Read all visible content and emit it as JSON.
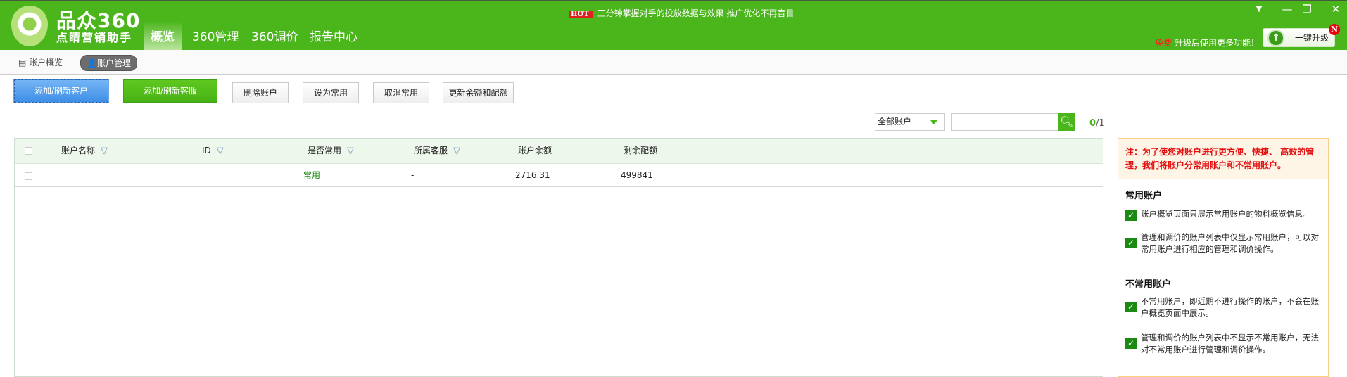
{
  "app": {
    "brand": "品众360",
    "slogan": "点睛营销助手"
  },
  "nav": {
    "tabs": [
      {
        "label": "概览",
        "active": true
      },
      {
        "label": "360管理"
      },
      {
        "label": "360调价"
      },
      {
        "label": "报告中心"
      }
    ]
  },
  "promo": {
    "badge": "HOT",
    "text": "三分钟掌握对手的投放数据与效果  推广优化不再盲目"
  },
  "window": {
    "menu": "▼",
    "minimize": "—",
    "maximize": "❐",
    "close": "✕"
  },
  "upgrade": {
    "free": "免费",
    "text": "升级后使用更多功能！",
    "button": "一键升级",
    "badge": "N"
  },
  "subnav": {
    "items": [
      {
        "label": "账户概览"
      },
      {
        "label": "账户管理",
        "active": true
      }
    ]
  },
  "toolbar": {
    "add_client": "添加/刷新客户",
    "add_service": "添加/刷新客服",
    "delete": "删除账户",
    "set_common": "设为常用",
    "cancel_common": "取消常用",
    "update_balance": "更新余额和配额"
  },
  "filter": {
    "select_value": "全部账户",
    "search_placeholder": "",
    "page_current": "0",
    "page_total": "/1"
  },
  "table": {
    "headers": [
      "账户名称",
      "ID",
      "是否常用",
      "所属客服",
      "账户余额",
      "剩余配额"
    ],
    "rows": [
      {
        "name": "",
        "id": "",
        "common": "常用",
        "service": "-",
        "balance": "2716.31",
        "quota": "499841"
      }
    ]
  },
  "panel": {
    "note": "注：为了使您对账户进行更方便、快捷、 高效的管理，我们将账户分常用账户和不常用账户。",
    "common_title": "常用账户",
    "common_items": [
      "账户概览页面只展示常用账户的物料概览信息。",
      "管理和调价的账户列表中仅显示常用账户，可以对常用账户进行相应的管理和调价操作。"
    ],
    "uncommon_title": "不常用账户",
    "uncommon_items": [
      "不常用账户，即近期不进行操作的账户，不会在账户概览页面中展示。",
      "管理和调价的账户列表中不显示不常用账户，无法对不常用账户进行管理和调价操作。"
    ]
  },
  "colors": {
    "brand_green": "#4bb51c",
    "accent_blue": "#3f8ee6",
    "note_red": "#e41010"
  }
}
